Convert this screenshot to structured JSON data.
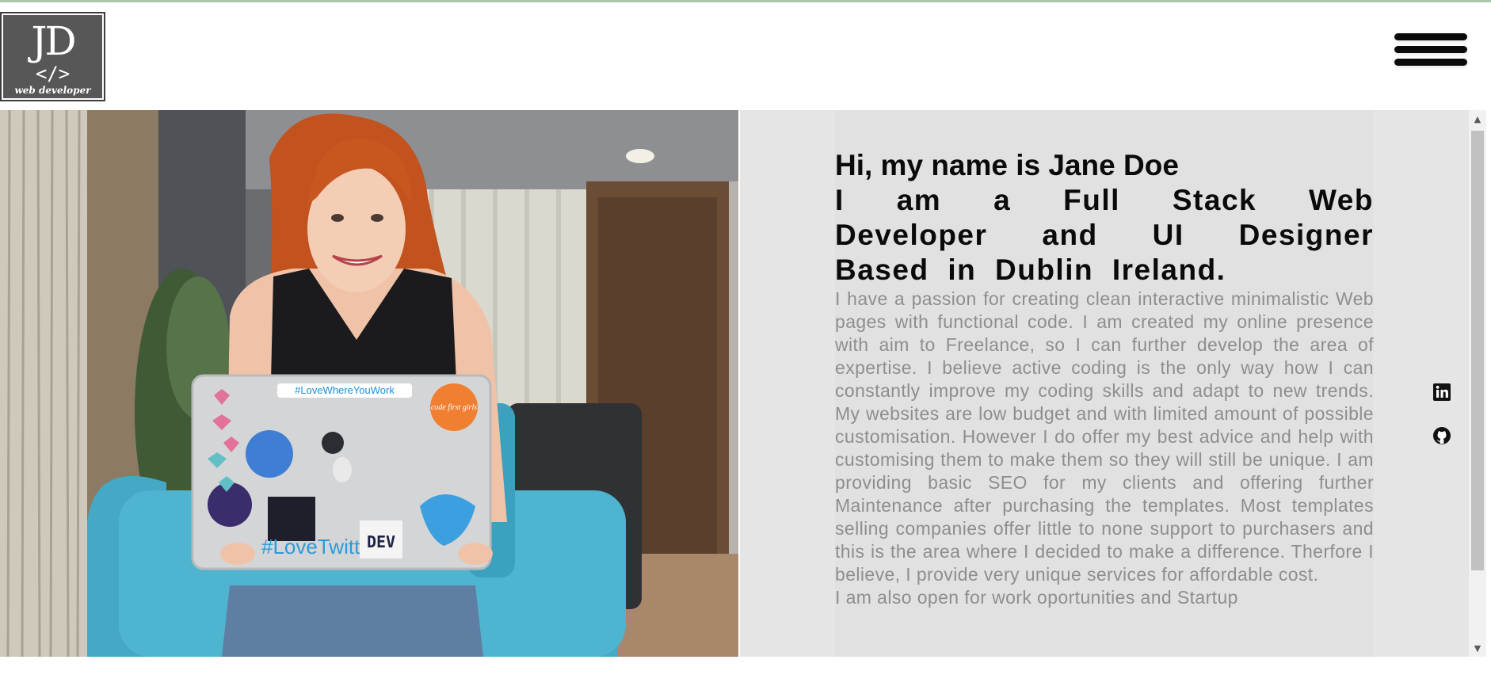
{
  "header": {
    "logo": {
      "initials": "JD",
      "tag": "</>",
      "subtitle": "web developer"
    },
    "menu_icon": "hamburger-menu-icon"
  },
  "photo": {
    "laptop_stickers": [
      "#LoveWhereYouWork",
      "#LoveTwitter",
      "DEV",
      "code first girls"
    ]
  },
  "intro": {
    "greeting": "Hi, my name is Jane Doe",
    "role": "I am a Full Stack Web Developer and UI Designer Based in Dublin Ireland.",
    "bio": "I have a passion for creating clean interactive minimalistic Web pages with functional code. I am created my online presence with aim to Freelance, so I can further develop the area of expertise. I believe active coding is the only way how I can constantly improve my coding skills and adapt to new trends. My websites are low budget and with limited amount of possible customisation. However I do offer my best advice and help with customising them to make them so they will still be unique. I am providing basic SEO for my clients and offering further Maintenance after purchasing the templates. Most templates selling companies offer little to none support to purchasers and this is the area where I decided to make a difference. Therfore I believe, I provide very unique services for affordable cost.",
    "bio_2": "I am also open for work oportunities and Startup"
  },
  "social": {
    "linkedin_icon": "linkedin-icon",
    "github_icon": "github-icon"
  },
  "colors": {
    "panel_bg": "#e5e5e5",
    "heading": "#0a0a0a",
    "body_text": "#8e8e8e",
    "chair": "#4fb4cf",
    "hair": "#c2521e"
  }
}
